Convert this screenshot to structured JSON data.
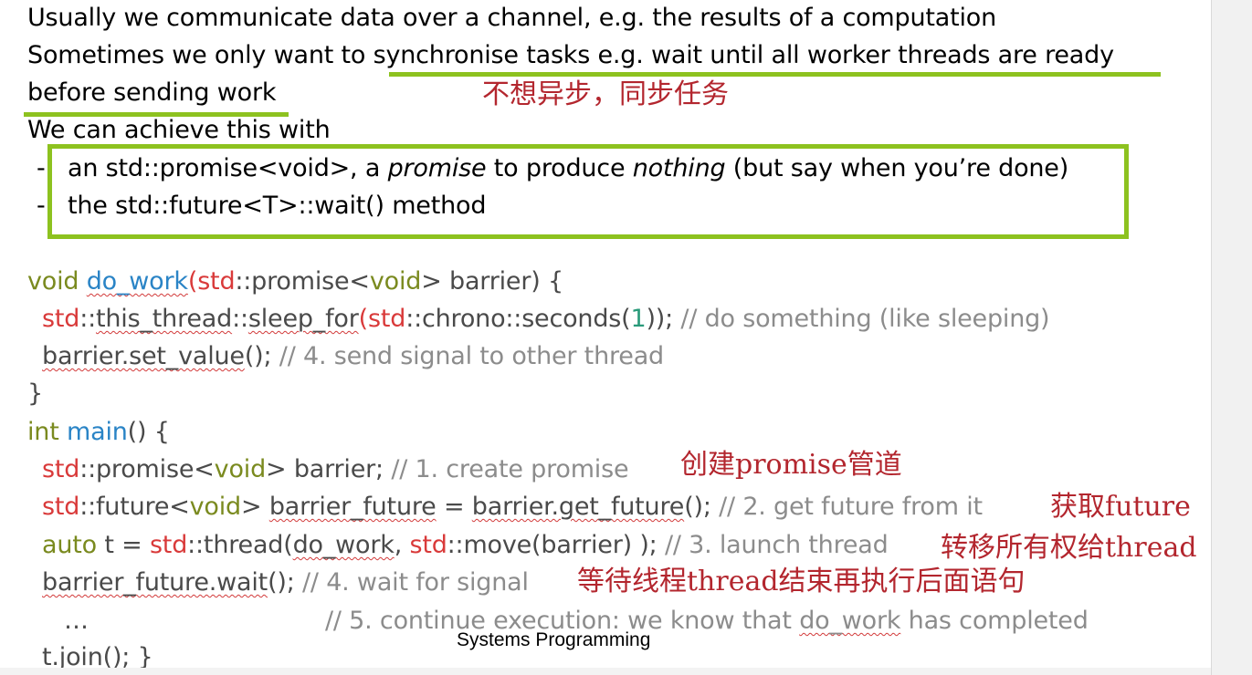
{
  "slide": {
    "intro": [
      "Usually we communicate data over a channel, e.g. the results of a computation",
      "Sometimes we only want to ",
      "synchronise tasks e.g. wait until all worker threads are ready",
      "before sending work",
      "We can achieve this with"
    ],
    "bullets": {
      "b1_a": "an std::promise<void>, a ",
      "b1_b": "promise",
      "b1_c": " to produce ",
      "b1_d": "nothing",
      "b1_e": " (but say when you’re done)",
      "b2": "the std::future<T>::wait() method",
      "dash": "-"
    },
    "annotations": {
      "sync": "不想异步，同步任务",
      "create": "创建promise管道",
      "get": "获取future",
      "move": "转移所有权给thread",
      "wait": "等待线程thread结束再执行后面语句"
    },
    "code": {
      "l1": [
        "void",
        " ",
        "do_work",
        "(",
        "std",
        "::promise<",
        "void",
        "> barrier) {"
      ],
      "l2": [
        "std",
        "::",
        "this_thread",
        "::",
        "sleep_for",
        "(",
        "std",
        "::chrono::seconds(",
        "1",
        ")); ",
        "// do something (like sleeping)"
      ],
      "l3": [
        "barrier.set_value",
        "(); ",
        "// 4. send signal to other thread"
      ],
      "l4": [
        "}"
      ],
      "l5": [
        "int",
        " ",
        "main",
        "() {"
      ],
      "l6": [
        "std",
        "::promise<",
        "void",
        "> barrier; ",
        "// 1. create promise"
      ],
      "l7": [
        "std",
        "::future<",
        "void",
        "> ",
        "barrier_future",
        " = ",
        "barrier.get_future",
        "(); ",
        "// 2. get future from it"
      ],
      "l8": [
        "auto",
        " t = ",
        "std",
        "::thread(",
        "do_work",
        ", ",
        "std",
        "::move(barrier) ); ",
        "// 3. launch thread"
      ],
      "l9": [
        "barrier_future.wait",
        "(); ",
        "// 4. wait for signal"
      ],
      "l10": [
        "…",
        "// 5. continue execution: we know that ",
        "do_work",
        " has completed"
      ],
      "l11": [
        "t.join",
        "(); }"
      ]
    },
    "footer": "Systems Programming"
  },
  "colors": {
    "highlight": "#8dc21f",
    "annotation": "#b3262e",
    "keyword": "#7a8a1f",
    "function": "#2a84c6",
    "namespace": "#d93a3a",
    "comment": "#8c8c8c"
  }
}
